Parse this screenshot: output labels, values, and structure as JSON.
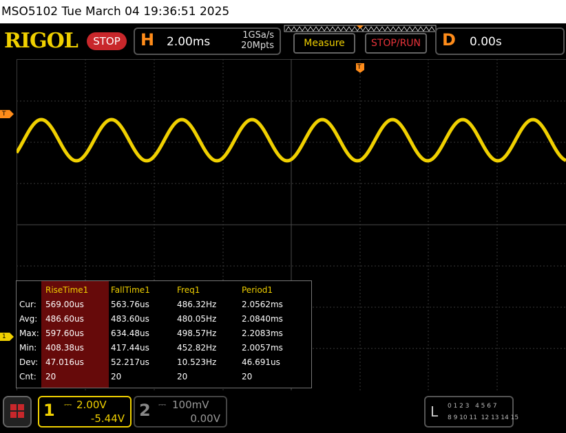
{
  "titlebar": {
    "text": "MSO5102  Tue March 04 19:36:51 2025"
  },
  "brand": {
    "logo": "RIGOL",
    "run_state": "STOP"
  },
  "horizontal": {
    "letter": "H",
    "timebase": "2.00ms",
    "sample_rate": "1GSa/s",
    "memory_depth": "20Mpts"
  },
  "buttons": {
    "measure": "Measure",
    "stop_run": "STOP/RUN"
  },
  "delay": {
    "letter": "D",
    "value": "0.00s"
  },
  "markers": {
    "trigger_top": "T",
    "trigger_level": "T",
    "channel1": "1"
  },
  "measurements": {
    "columns": [
      "",
      "RiseTime1",
      "FallTime1",
      "Freq1",
      "Period1"
    ],
    "rows": [
      [
        "Cur:",
        "569.00us",
        "563.76us",
        "486.32Hz",
        "2.0562ms"
      ],
      [
        "Avg:",
        "486.60us",
        "483.60us",
        "480.05Hz",
        "2.0840ms"
      ],
      [
        "Max:",
        "597.60us",
        "634.48us",
        "498.57Hz",
        "2.2083ms"
      ],
      [
        "Min:",
        "408.38us",
        "417.44us",
        "452.82Hz",
        "2.0057ms"
      ],
      [
        "Dev:",
        "47.016us",
        "52.217us",
        "10.523Hz",
        "46.691us"
      ],
      [
        "Cnt:",
        "20",
        "20",
        "20",
        "20"
      ]
    ]
  },
  "channel1": {
    "number": "1",
    "scale": "2.00V",
    "offset": "-5.44V"
  },
  "channel2": {
    "number": "2",
    "scale": "100mV",
    "offset": "0.00V"
  },
  "logic": {
    "letter": "L",
    "row1": "0 1 2 3   4 5 6 7",
    "row2": "8 9 10 11  12 13 14 15"
  },
  "colors": {
    "ch1": "#f0d000",
    "accent": "#ff8c1a",
    "stop": "#c8272b",
    "grid": "#3a3a3a"
  }
}
